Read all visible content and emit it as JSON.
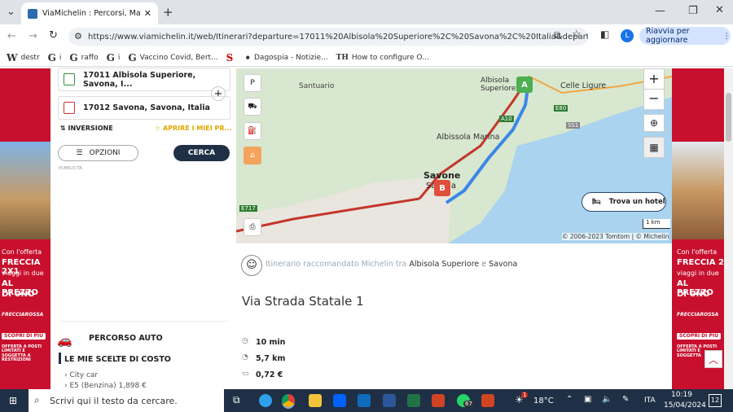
{
  "browser": {
    "tab_title": "ViaMichelin : Percorsi, Mappe, ...",
    "url": "https://www.viamichelin.it/web/Itinerari?departure=17011%20Albisola%20Superiore%2C%20Savona%2C%20Italia&departureTid...",
    "relaunch_label": "Riavvia per aggiornare",
    "profile_initial": "L",
    "bookmarks": [
      {
        "icon": "W",
        "label": "destr"
      },
      {
        "icon": "G",
        "label": "i"
      },
      {
        "icon": "G",
        "label": "raffo"
      },
      {
        "icon": "G",
        "label": "i"
      },
      {
        "icon": "G",
        "label": "Vaccino Covid, Bert..."
      },
      {
        "icon": "S",
        "label": ""
      },
      {
        "icon": "•",
        "label": "Dagospia - Notizie..."
      },
      {
        "icon": "TH",
        "label": "How to configure O..."
      }
    ]
  },
  "form": {
    "departure": "17011 Albisola Superiore, Savona, I...",
    "arrival": "17012 Savona, Savona, Italia",
    "inversion_label": "INVERSIONE",
    "favorites_label": "APRIRE I MIEI PR...",
    "options_label": "OPZIONI",
    "search_label": "CERCA",
    "ad_label": "PUBBLICITÀ"
  },
  "car": {
    "title": "PERCORSO AUTO",
    "costs_title": "LE MIE SCELTE DI COSTO",
    "car_type": "City car",
    "fuel": "E5 (Benzina) 1,898 €"
  },
  "map": {
    "places": [
      "Santuario",
      "Albisola Superiore",
      "Celle Ligure",
      "Albissola Marina",
      "Savone",
      "Savona"
    ],
    "roads": [
      "A10",
      "E80",
      "SS1",
      "E717"
    ],
    "marker_a": "A",
    "marker_b": "B",
    "hotel_label": "Trova un hotel",
    "scale": "1 km",
    "copyright": "© 2006-2023 Tomtom | © Michelin"
  },
  "route": {
    "intro": "Itinerario raccomandato Michelin tra",
    "from": "Albisola Superiore",
    "connector": "e",
    "to": "Savona",
    "road_name": "Via Strada Statale 1",
    "duration": "10 min",
    "distance": "5,7 km",
    "cost": "0,72 €"
  },
  "ads": {
    "left_lines": [
      "Con l'offerta",
      "FRECCIA 2X1",
      "viaggi in due",
      "AL PREZZO",
      "DI UNO",
      "FRECCIAROSSA",
      "SCOPRI DI PIÙ",
      "OFFERTA A POSTI LIMITATI E SOGGETTA A RESTRIZIONI"
    ],
    "right_lines": [
      "Con l'offerta",
      "FRECCIA 2",
      "viaggi in due",
      "AL PREZZO",
      "DI UNO",
      "FRECCIAROSSA",
      "SCOPRI DI PIÙ",
      "OFFERTA A POSTI LIMITATI E SOGGETTA"
    ]
  },
  "taskbar": {
    "search_placeholder": "Scrivi qui il testo da cercare.",
    "weather": "18°C",
    "lang": "ITA",
    "time": "10:19",
    "date": "15/04/2024",
    "notif": "12",
    "badge_whatsapp": "67",
    "badge_weather": "1"
  }
}
